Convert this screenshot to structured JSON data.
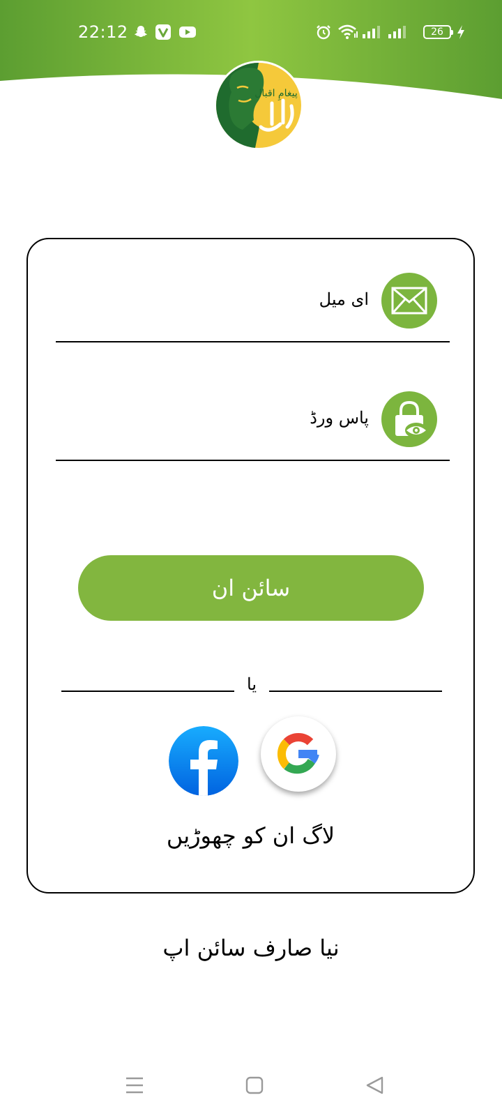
{
  "status_bar": {
    "time": "22:12",
    "notification_icons": [
      "snapchat-icon",
      "v-app-icon",
      "youtube-icon"
    ],
    "system_icons": [
      "alarm-icon",
      "wifi-icon",
      "signal-icon",
      "signal-icon-2",
      "battery-icon",
      "charging-icon"
    ],
    "battery_level": "26"
  },
  "colors": {
    "brand_green": "#7cb53e",
    "banner_green_light": "#8fc641",
    "banner_green_dark": "#5c9e31",
    "logo_yellow": "#f5c93a",
    "logo_dark_green": "#1f6b2e"
  },
  "logo": {
    "label": "پیغامِ اقبال",
    "icon": "iqbal-portrait-logo"
  },
  "form": {
    "email": {
      "label": "ای میل",
      "icon": "mail-icon",
      "value": ""
    },
    "password": {
      "label": "پاس ورڈ",
      "icon": "lock-eye-icon",
      "value": ""
    },
    "signin_label": "سائن ان",
    "or_text": "یا",
    "social": {
      "facebook_icon": "facebook-icon",
      "google_icon": "google-icon"
    },
    "skip_label": "لاگ ان کو چھوڑیں"
  },
  "signup_label": "نیا صارف سائن اپ",
  "nav_bar": {
    "items": [
      "recents-icon",
      "home-icon",
      "back-icon"
    ]
  }
}
